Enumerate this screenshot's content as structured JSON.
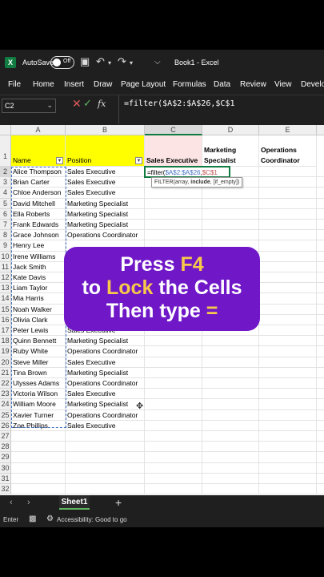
{
  "titlebar": {
    "autosave_label": "AutoSave",
    "autosave_state": "Off",
    "workbook_title": "Book1 - Excel"
  },
  "menu": [
    "File",
    "Home",
    "Insert",
    "Draw",
    "Page Layout",
    "Formulas",
    "Data",
    "Review",
    "View",
    "Develo"
  ],
  "formula_bar": {
    "name_box": "C2",
    "fx": "fx",
    "formula": "=filter($A$2:$A$26,$C$1"
  },
  "columns": [
    "A",
    "B",
    "C",
    "D",
    "E"
  ],
  "row_numbers": [
    "1",
    "2",
    "3",
    "4",
    "5",
    "6",
    "7",
    "8",
    "9",
    "10",
    "11",
    "12",
    "13",
    "14",
    "15",
    "16",
    "17",
    "18",
    "19",
    "20",
    "21",
    "22",
    "23",
    "24",
    "25",
    "26",
    "27",
    "28",
    "29",
    "30",
    "31",
    "32"
  ],
  "headers": {
    "name": "Name",
    "position": "Position",
    "c1": "Sales Executive",
    "d1_line1": "Marketing",
    "d1_line2": "Specialist",
    "e1_line1": "Operations",
    "e1_line2": "Coordinator"
  },
  "active_cell": {
    "prefix": "=filter(",
    "ref1": "$A$2:$A$26",
    "sep": ",",
    "ref2": "$C$1"
  },
  "tooltip": {
    "func": "FILTER(array, ",
    "bold_arg": "include",
    "rest": ", [if_empty])"
  },
  "rows": [
    {
      "name": "Alice Thompson",
      "position": "Sales Executive"
    },
    {
      "name": "Brian Carter",
      "position": "Sales Executive"
    },
    {
      "name": "Chloe Anderson",
      "position": "Sales Executive"
    },
    {
      "name": "David Mitchell",
      "position": "Marketing Specialist"
    },
    {
      "name": "Ella Roberts",
      "position": "Marketing Specialist"
    },
    {
      "name": "Frank Edwards",
      "position": "Marketing Specialist"
    },
    {
      "name": "Grace Johnson",
      "position": "Operations Coordinator"
    },
    {
      "name": "Henry Lee",
      "position": ""
    },
    {
      "name": "Irene Williams",
      "position": ""
    },
    {
      "name": "Jack Smith",
      "position": ""
    },
    {
      "name": "Kate Davis",
      "position": ""
    },
    {
      "name": "Liam Taylor",
      "position": ""
    },
    {
      "name": "Mia Harris",
      "position": ""
    },
    {
      "name": "Noah Walker",
      "position": ""
    },
    {
      "name": "Olivia Clark",
      "position": ""
    },
    {
      "name": "Peter Lewis",
      "position": "Sales Executive"
    },
    {
      "name": "Quinn Bennett",
      "position": "Marketing Specialist"
    },
    {
      "name": "Ruby White",
      "position": "Operations Coordinator"
    },
    {
      "name": "Steve Miller",
      "position": "Sales Executive"
    },
    {
      "name": "Tina Brown",
      "position": "Marketing Specialist"
    },
    {
      "name": "Ulysses Adams",
      "position": "Operations Coordinator"
    },
    {
      "name": "Victoria Wilson",
      "position": "Sales Executive"
    },
    {
      "name": "William Moore",
      "position": "Marketing Specialist"
    },
    {
      "name": "Xavier Turner",
      "position": "Operations Coordinator"
    },
    {
      "name": "Zoe Phillips",
      "position": "Sales Executive"
    }
  ],
  "overlay": {
    "line1_a": "Press ",
    "line1_b": "F4",
    "line2_a": "to ",
    "line2_b": "Lock",
    "line2_c": " the Cells",
    "line3_a": "Then type ",
    "line3_b": "="
  },
  "sheetbar": {
    "sheet_name": "Sheet1",
    "add": "+"
  },
  "statusbar": {
    "mode": "Enter",
    "accessibility": "Accessibility: Good to go"
  }
}
